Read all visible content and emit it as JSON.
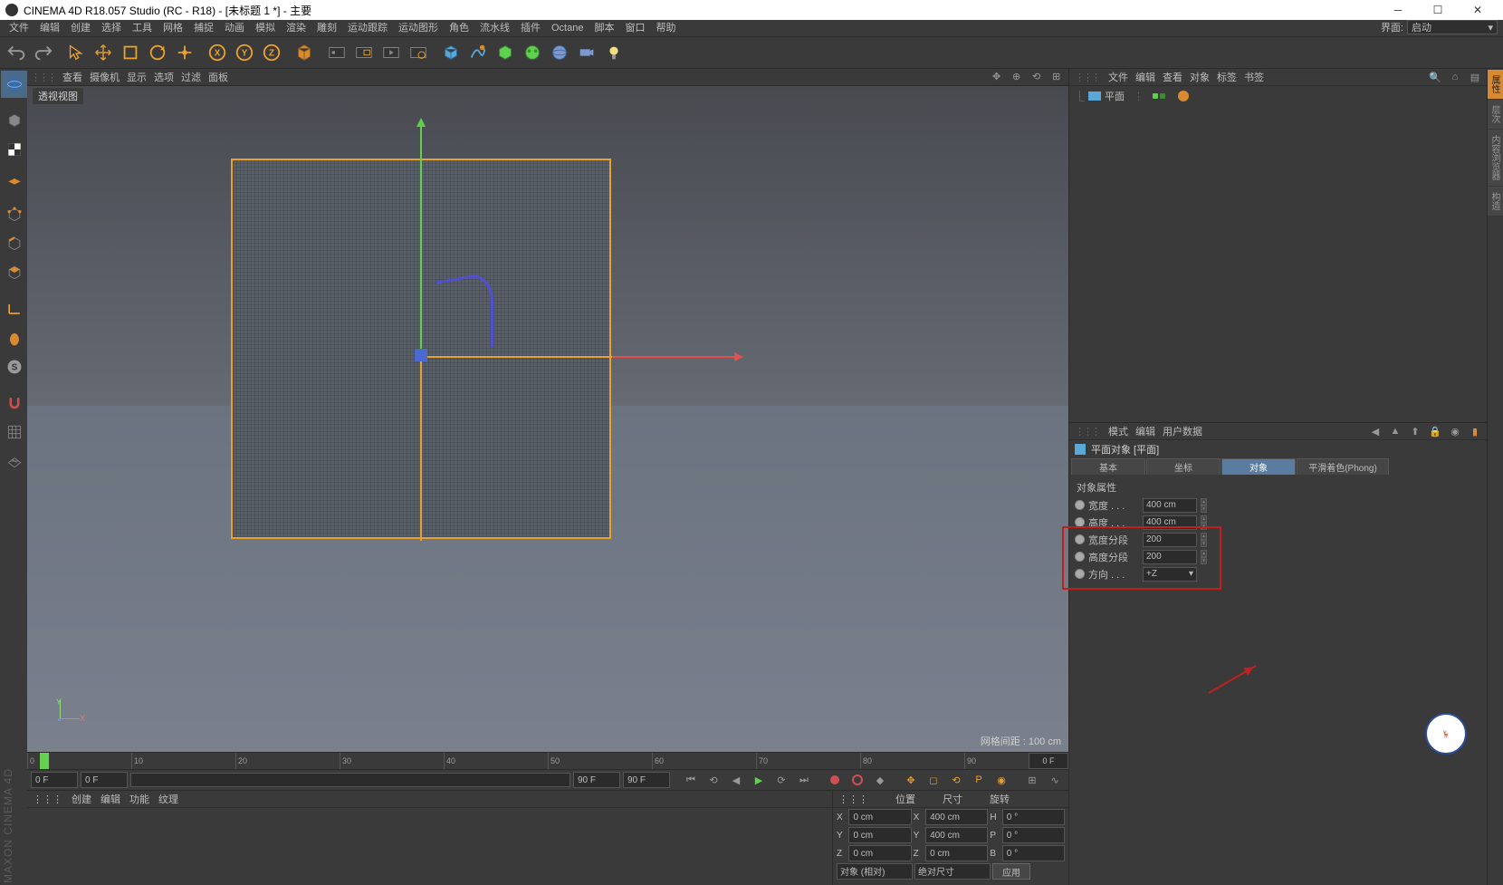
{
  "title": "CINEMA 4D R18.057 Studio (RC - R18) - [未标题 1 *] - 主要",
  "menu": [
    "文件",
    "编辑",
    "创建",
    "选择",
    "工具",
    "网格",
    "捕捉",
    "动画",
    "模拟",
    "渲染",
    "雕刻",
    "运动跟踪",
    "运动图形",
    "角色",
    "流水线",
    "插件",
    "Octane",
    "脚本",
    "窗口",
    "帮助"
  ],
  "layout_label": "界面:",
  "layout_value": "启动",
  "viewport": {
    "menu": [
      "查看",
      "摄像机",
      "显示",
      "选项",
      "过滤",
      "面板"
    ],
    "label": "透视视图",
    "grid_status": "网格间距 : 100 cm"
  },
  "timeline": {
    "marks": [
      "0",
      "10",
      "20",
      "30",
      "40",
      "50",
      "60",
      "70",
      "80",
      "90"
    ],
    "end": "0 F",
    "f_start": "0 F",
    "f_cur": "0 F",
    "f_a": "90 F",
    "f_b": "90 F"
  },
  "matpanel_menu": [
    "创建",
    "编辑",
    "功能",
    "纹理"
  ],
  "coord": {
    "headers": [
      "位置",
      "尺寸",
      "旋转"
    ],
    "rows": [
      {
        "axis": "X",
        "pos": "0 cm",
        "size": "400 cm",
        "rotlbl": "H",
        "rot": "0 °"
      },
      {
        "axis": "Y",
        "pos": "0 cm",
        "size": "400 cm",
        "rotlbl": "P",
        "rot": "0 °"
      },
      {
        "axis": "Z",
        "pos": "0 cm",
        "size": "0 cm",
        "rotlbl": "B",
        "rot": "0 °"
      }
    ],
    "mode1": "对象 (相对)",
    "mode2": "绝对尺寸",
    "apply": "应用"
  },
  "objmgr": {
    "menu": [
      "文件",
      "编辑",
      "查看",
      "对象",
      "标签",
      "书签"
    ],
    "item": "平面"
  },
  "attrmgr": {
    "menu": [
      "模式",
      "编辑",
      "用户数据"
    ],
    "title": "平面对象 [平面]",
    "tabs": [
      "基本",
      "坐标",
      "对象",
      "平滑着色(Phong)"
    ],
    "section": "对象属性",
    "props": [
      {
        "label": "宽度 . . .",
        "value": "400 cm"
      },
      {
        "label": "高度 . . .",
        "value": "400 cm"
      },
      {
        "label": "宽度分段",
        "value": "200"
      },
      {
        "label": "高度分段",
        "value": "200"
      },
      {
        "label": "方向 . . .",
        "value": "+Z"
      }
    ]
  },
  "gizmo_y": "Y",
  "gizmo_x": "X",
  "brand": "MAXON\nCINEMA 4D"
}
